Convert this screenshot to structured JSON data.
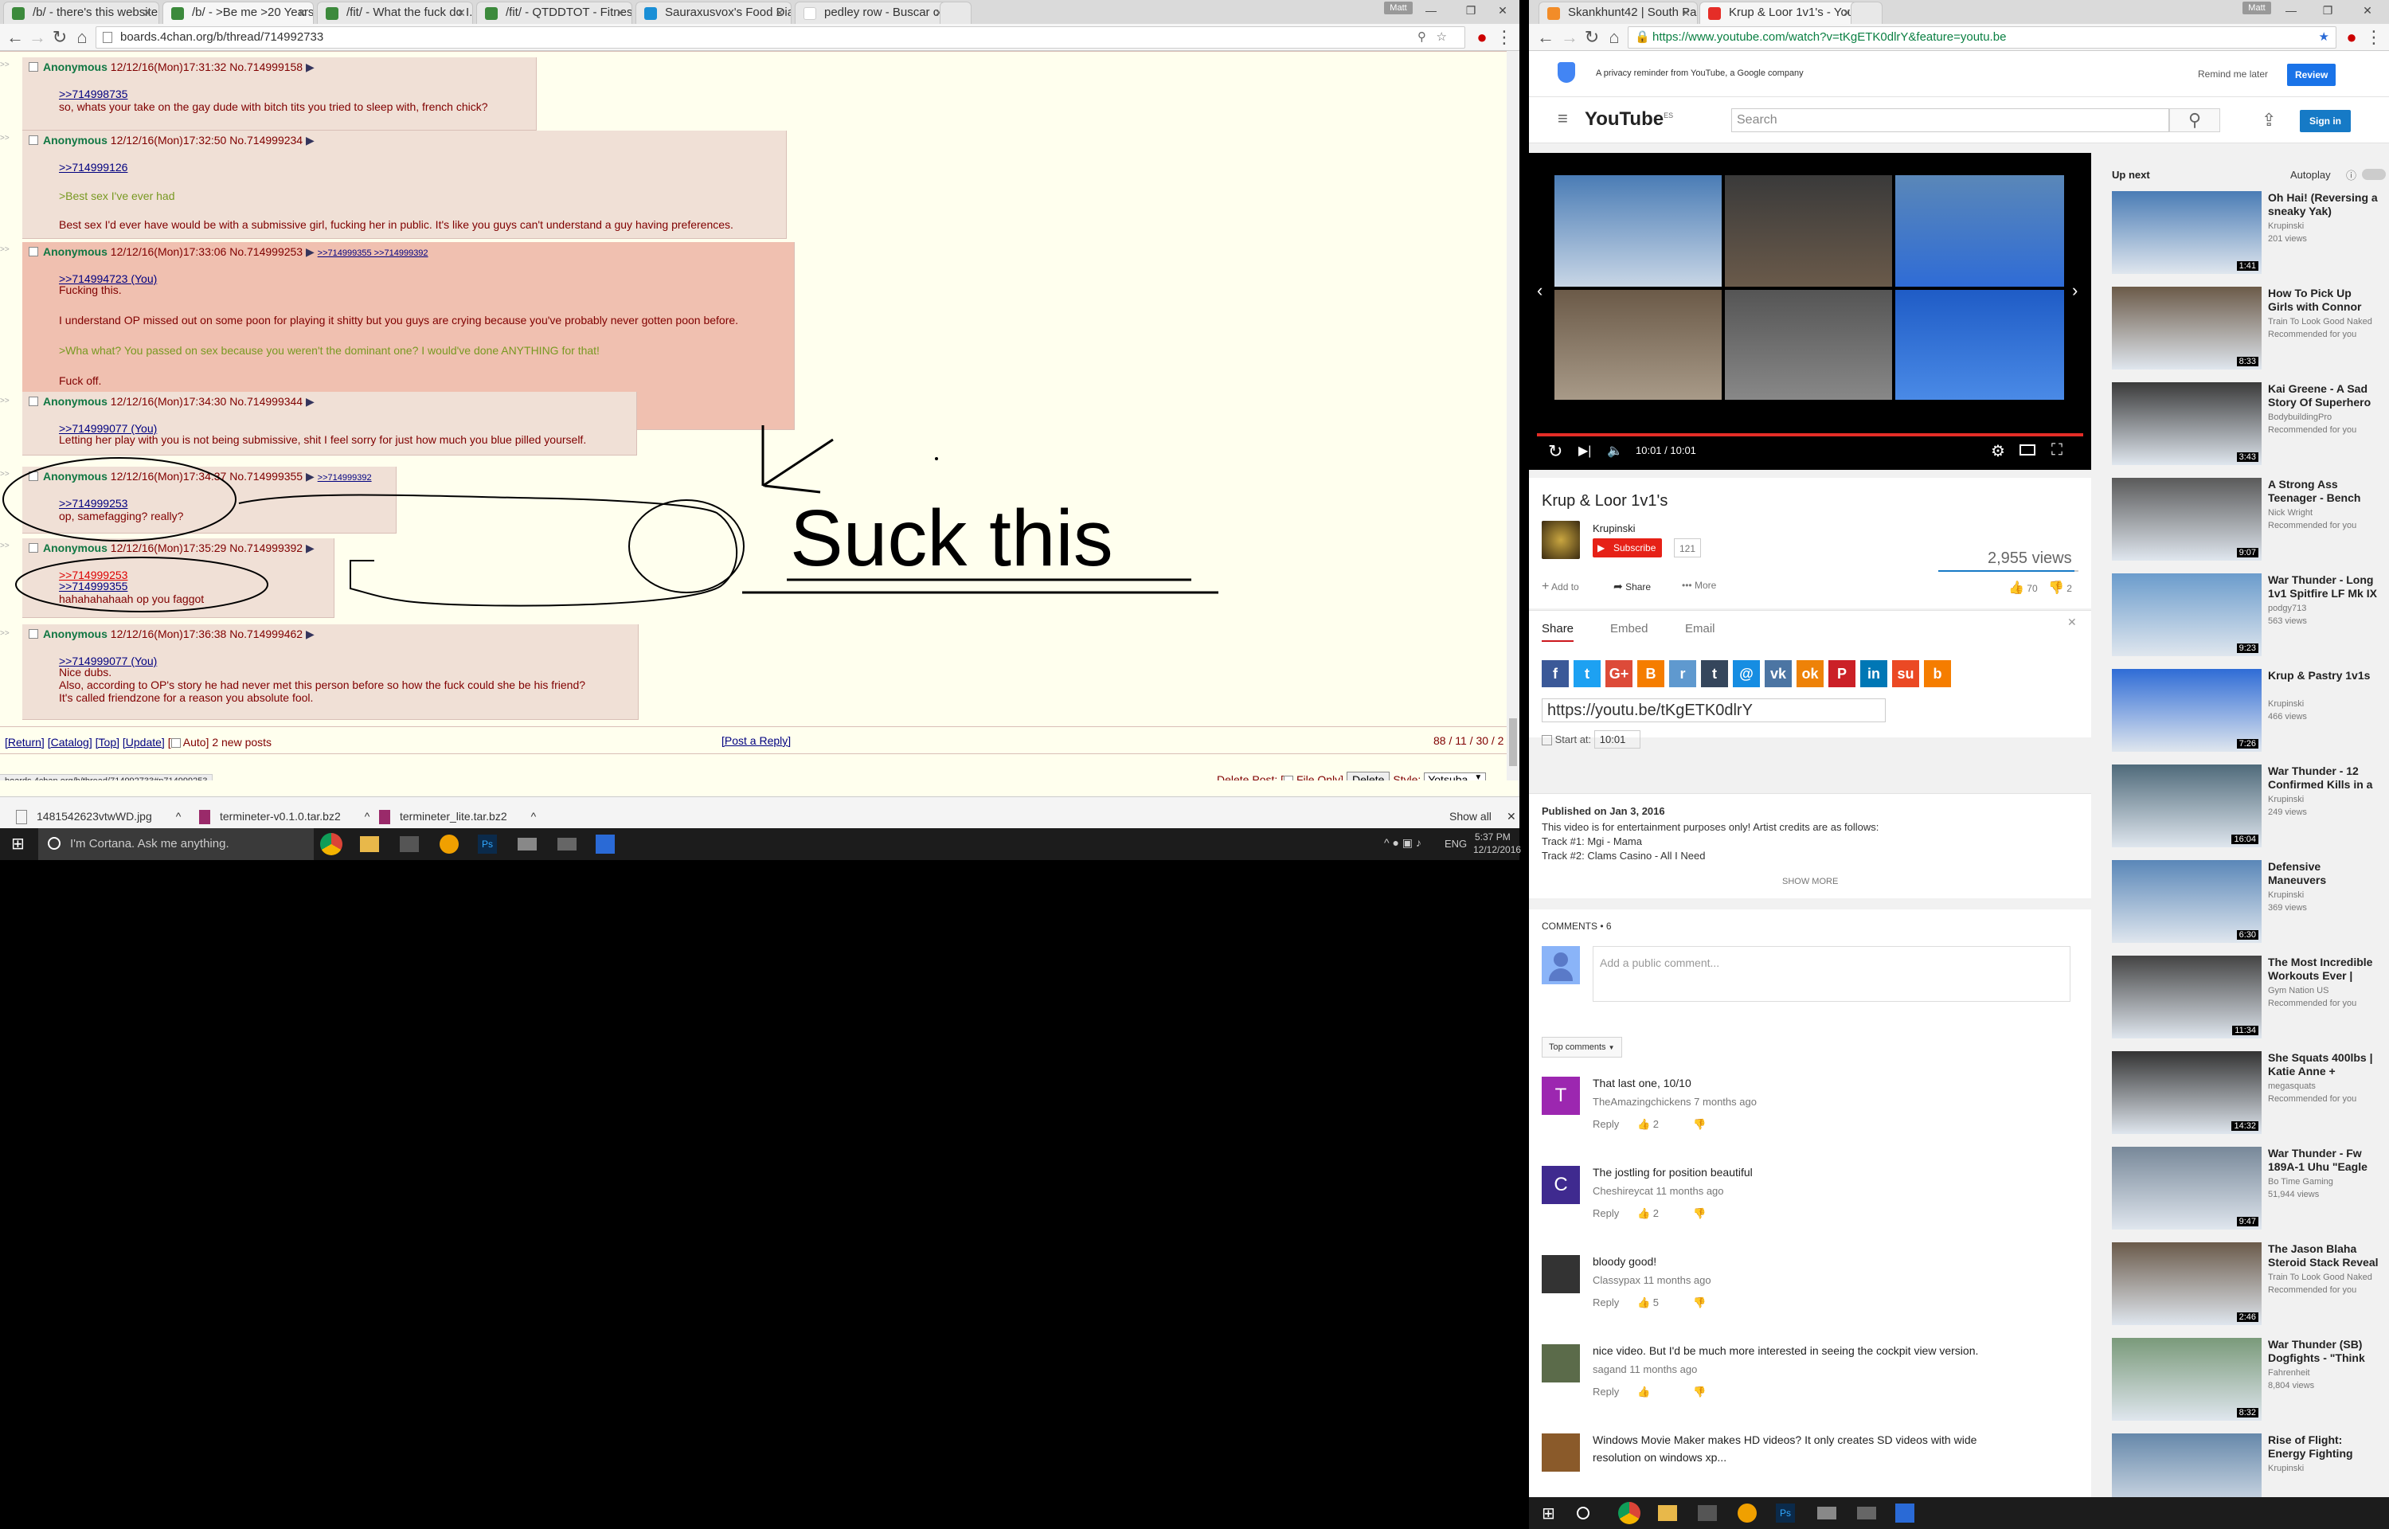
{
  "left_window": {
    "tabs": [
      {
        "title": "/b/ - there's this website"
      },
      {
        "title": "/b/ - >Be me >20 Years o..."
      },
      {
        "title": "/fit/ - What the fuck do I..."
      },
      {
        "title": "/fit/ - QTDDTOT - Fitness..."
      },
      {
        "title": "Sauraxusvox's Food Diar..."
      },
      {
        "title": "pedley row - Buscar con..."
      }
    ],
    "address": "boards.4chan.org/b/thread/714992733",
    "profile": "Matt",
    "posts": [
      {
        "name": "Anonymous",
        "date": "12/12/16(Mon)17:31:32",
        "no": "No.714999158",
        "replies": "",
        "lines": [
          ">>714998735",
          "so, whats your take on the gay dude with bitch tits you tried to sleep with, french chick?"
        ]
      },
      {
        "name": "Anonymous",
        "date": "12/12/16(Mon)17:32:50",
        "no": "No.714999234",
        "replies": "",
        "lines": [
          ">>714999126",
          "",
          ">Best sex I've ever had",
          "",
          "Best sex I'd ever have would be with a submissive girl, fucking her in public. It's like you guys can't understand a guy having preferences."
        ]
      },
      {
        "name": "Anonymous",
        "date": "12/12/16(Mon)17:33:06",
        "no": "No.714999253",
        "replies": ">>714999355 >>714999392",
        "lines": [
          ">>714994723 (You)",
          "Fucking this.",
          "",
          "I understand OP missed out on some poon for playing it shitty but you guys are crying because you've probably never gotten poon before.",
          "",
          ">Wha what? You passed on sex because you weren't the dominant one? I would've done ANYTHING for that!",
          "",
          "Fuck off."
        ]
      },
      {
        "name": "Anonymous",
        "date": "12/12/16(Mon)17:34:30",
        "no": "No.714999344",
        "replies": "",
        "lines": [
          ">>714999077 (You)",
          "Letting her play with you is not being submissive, shit I feel sorry for just how much you blue pilled yourself."
        ]
      },
      {
        "name": "Anonymous",
        "date": "12/12/16(Mon)17:34:37",
        "no": "No.714999355",
        "replies": ">>714999392",
        "lines": [
          ">>714999253",
          "op, samefagging? really?"
        ]
      },
      {
        "name": "Anonymous",
        "date": "12/12/16(Mon)17:35:29",
        "no": "No.714999392",
        "replies": "",
        "lines": [
          ">>714999253",
          ">>714999355",
          "hahahahahaah op you faggot"
        ]
      },
      {
        "name": "Anonymous",
        "date": "12/12/16(Mon)17:36:38",
        "no": "No.714999462",
        "replies": "",
        "lines": [
          ">>714999077 (You)",
          "Nice dubs.",
          "Also, according to OP's story he had never met this person before so how the fuck could she be his friend?",
          "It's called friendzone for a reason you absolute fool."
        ]
      }
    ],
    "drawn_text": "Suck this",
    "footer_links": [
      "[Return]",
      "[Catalog]",
      "[Top]",
      "[Update]",
      "[",
      "Auto]",
      "2 new posts"
    ],
    "post_reply": "[Post a Reply]",
    "stats": "88 / 11 / 30 / 2",
    "status_url": "boards.4chan.org/b/thread/714992733#p714999253",
    "delete_post": "Delete Post: [",
    "file_only": "File Only]",
    "delete_btn": "Delete",
    "style_label": "Style:",
    "style_value": "Yotsuba",
    "downloads": [
      "1481542623vtwWD.jpg",
      "termineter-v0.1.0.tar.bz2",
      "termineter_lite.tar.bz2"
    ],
    "show_all": "Show all",
    "cortana": "I'm Cortana. Ask me anything.",
    "lang": "ENG",
    "time": "5:37 PM",
    "date": "12/12/2016"
  },
  "right_window": {
    "tabs": [
      {
        "title": "Skankhunt42 | South Par..."
      },
      {
        "title": "Krup & Loor 1v1's - YouT..."
      }
    ],
    "address": "https://www.youtube.com/watch?v=tKgETK0dlrY&feature=youtu.be",
    "profile": "Matt",
    "privacy_text": "A privacy reminder from YouTube, a Google company",
    "remind_later": "Remind me later",
    "review": "Review",
    "logo": "YouTube",
    "logo_region": "ES",
    "search_placeholder": "Search",
    "sign_in": "Sign in",
    "player_time": "10:01 / 10:01",
    "title": "Krup & Loor 1v1's",
    "channel": "Krupinski",
    "subscribe": "Subscribe",
    "sub_count": "121",
    "views": "2,955 views",
    "add_to": "Add to",
    "share": "Share",
    "more": "More",
    "likes": "70",
    "dislikes": "2",
    "share_tabs": [
      "Share",
      "Embed",
      "Email"
    ],
    "share_services": [
      {
        "name": "facebook-icon",
        "glyph": "f",
        "color": "#3b5998"
      },
      {
        "name": "twitter-icon",
        "glyph": "t",
        "color": "#1da1f2"
      },
      {
        "name": "google-plus-icon",
        "glyph": "G+",
        "color": "#dd4b39"
      },
      {
        "name": "blogger-icon",
        "glyph": "B",
        "color": "#f57d00"
      },
      {
        "name": "reddit-icon",
        "glyph": "r",
        "color": "#5f99cf"
      },
      {
        "name": "tumblr-icon",
        "glyph": "t",
        "color": "#35465c"
      },
      {
        "name": "odnoklassniki-mail-icon",
        "glyph": "@",
        "color": "#168de2"
      },
      {
        "name": "vk-icon",
        "glyph": "vk",
        "color": "#4c75a3"
      },
      {
        "name": "ok-icon",
        "glyph": "ok",
        "color": "#ee8208"
      },
      {
        "name": "pinterest-icon",
        "glyph": "P",
        "color": "#cb2027"
      },
      {
        "name": "linkedin-icon",
        "glyph": "in",
        "color": "#0077b5"
      },
      {
        "name": "stumbleupon-icon",
        "glyph": "su",
        "color": "#eb4924"
      },
      {
        "name": "blogger-alt-icon",
        "glyph": "b",
        "color": "#f57d00"
      }
    ],
    "share_url": "https://youtu.be/tKgETK0dlrY",
    "start_at_label": "Start at:",
    "start_at_value": "10:01",
    "published": "Published on Jan 3, 2016",
    "description": [
      "This video is for entertainment purposes only! Artist credits are as follows:",
      "Track #1: Mgi - Mama",
      "Track #2: Clams Casino - All I Need"
    ],
    "show_more": "SHOW MORE",
    "comments_label": "COMMENTS • 6",
    "comment_placeholder": "Add a public comment...",
    "top_comments": "Top comments",
    "comments": [
      {
        "avatar": "T",
        "color": "#9c27b0",
        "text": "That last one, 10/10",
        "author": "TheAmazingchickens",
        "age": "7 months ago",
        "likes": "2"
      },
      {
        "avatar": "C",
        "color": "#3f2a8f",
        "text": "The jostling for position beautiful",
        "author": "Cheshireycat",
        "age": "11 months ago",
        "likes": "2"
      },
      {
        "avatar": "",
        "color": "#333333",
        "text": "bloody good!",
        "author": "Classypax",
        "age": "11 months ago",
        "likes": "5"
      },
      {
        "avatar": "",
        "color": "#5b6b4a",
        "text": "nice video. But I'd be much more interested in seeing the cockpit view version.",
        "author": "sagand",
        "age": "11 months ago",
        "likes": ""
      },
      {
        "avatar": "",
        "color": "#8a5a2a",
        "text": "Windows Movie Maker makes HD videos? It only creates SD videos with wide",
        "text2": "resolution on windows xp...",
        "author": "",
        "age": "",
        "likes": ""
      }
    ],
    "reply": "Reply",
    "up_next": "Up next",
    "autoplay": "Autoplay",
    "related": [
      {
        "title": "Oh Hai! (Reversing a sneaky Yak)",
        "channel": "Krupinski",
        "views": "201 views",
        "dur": "1:41",
        "color": "#4a7cb5"
      },
      {
        "title": "How To Pick Up Girls with Connor Murphy",
        "channel": "Train To Look Good Naked",
        "views": "Recommended for you",
        "dur": "8:33",
        "color": "#6b5a48"
      },
      {
        "title": "Kai Greene - A Sad Story Of Superhero",
        "channel": "BodybuildingPro",
        "views": "Recommended for you",
        "dur": "3:43",
        "color": "#3a3a3a"
      },
      {
        "title": "A Strong Ass Teenager - Bench Day",
        "channel": "Nick Wright",
        "views": "Recommended for you",
        "dur": "9:07",
        "color": "#5a5a5a"
      },
      {
        "title": "War Thunder - Long 1v1 Spitfire LF Mk IX",
        "channel": "podgy713",
        "views": "563 views",
        "dur": "9:23",
        "color": "#6b9ccc"
      },
      {
        "title": "Krup & Pastry 1v1s",
        "channel": "Krupinski",
        "views": "466 views",
        "dur": "7:26",
        "color": "#2f6cd6"
      },
      {
        "title": "War Thunder - 12 Confirmed Kills in a",
        "channel": "Krupinski",
        "views": "249 views",
        "dur": "16:04",
        "color": "#4f6a7a"
      },
      {
        "title": "Defensive Maneuvers",
        "channel": "Krupinski",
        "views": "369 views",
        "dur": "6:30",
        "color": "#5a87b8"
      },
      {
        "title": "The Most Incredible Workouts Ever |",
        "channel": "Gym Nation US",
        "views": "Recommended for you",
        "dur": "11:34",
        "color": "#444444"
      },
      {
        "title": "She Squats 400lbs | Katie Anne +",
        "channel": "megasquats",
        "views": "Recommended for you",
        "dur": "14:32",
        "color": "#333333"
      },
      {
        "title": "War Thunder - Fw 189A-1 Uhu \"Eagle",
        "channel": "Bo Time Gaming",
        "views": "51,944 views",
        "dur": "9:47",
        "color": "#778899"
      },
      {
        "title": "The Jason Blaha Steroid Stack Reveal",
        "channel": "Train To Look Good Naked",
        "views": "Recommended for you",
        "dur": "2:46",
        "color": "#6a5a4a"
      },
      {
        "title": "War Thunder (SB) Dogfights - \"Think",
        "channel": "Fahrenheit",
        "views": "8,804 views",
        "dur": "8:32",
        "color": "#7a9a7a"
      },
      {
        "title": "Rise of Flight: Energy Fighting",
        "channel": "Krupinski",
        "views": "",
        "dur": "",
        "color": "#6688aa"
      }
    ]
  }
}
